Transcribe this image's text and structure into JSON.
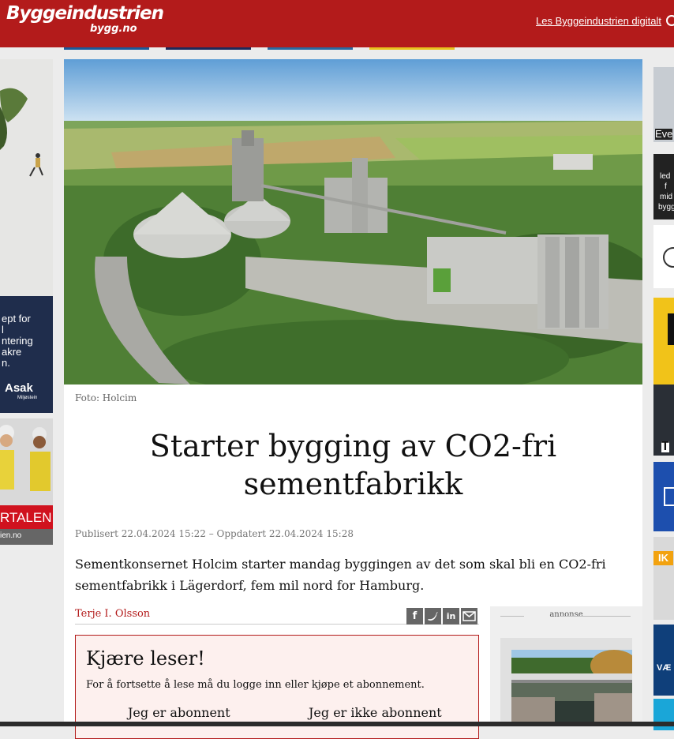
{
  "header": {
    "logo_main": "Byggeindustrien",
    "logo_sub": "bygg.no",
    "digital_link": "Les Byggeindustrien digitalt"
  },
  "left_ads": {
    "ad1_lines": [
      "ept for",
      "l",
      "ntering",
      "akre",
      "n."
    ],
    "ad1_brand": "Asak",
    "ad1_brand_sub": "Miljøstein",
    "ad2_banner": "RTALEN",
    "ad2_footer": "ien.no"
  },
  "right_ads": {
    "ad1_text": "Eve",
    "ad2_lines": [
      "led",
      "f",
      "mid",
      "bygg"
    ],
    "ad3_text": "IK",
    "ad4_text": "VÆ",
    "ad5_text": "T"
  },
  "article": {
    "photo_caption": "Foto: Holcim",
    "title_line1": "Starter bygging av CO2-fri",
    "title_line2": "sementfabrikk",
    "meta": "Publisert 22.04.2024 15:22 – Oppdatert 22.04.2024 15:28",
    "lead": "Sementkonsernet Holcim starter mandag byggingen av det som skal bli en CO2-fri sementfabrikk i Lägerdorf, fem mil nord for Hamburg.",
    "author": "Terje I. Olsson",
    "share_icons": [
      "facebook-icon",
      "twitter-icon",
      "linkedin-icon",
      "email-icon"
    ]
  },
  "paywall": {
    "heading": "Kjære leser!",
    "text": "For å fortsette å lese må du logge inn eller kjøpe et abonnement.",
    "subscriber_button": "Jeg er abonnent",
    "non_subscriber_button": "Jeg er ikke abonnent"
  },
  "sidebar": {
    "ad_label": "annonse"
  },
  "colors": {
    "brand_red": "#b31b1b",
    "share_grey": "#666666",
    "paywall_bg": "#fdf0ee"
  }
}
